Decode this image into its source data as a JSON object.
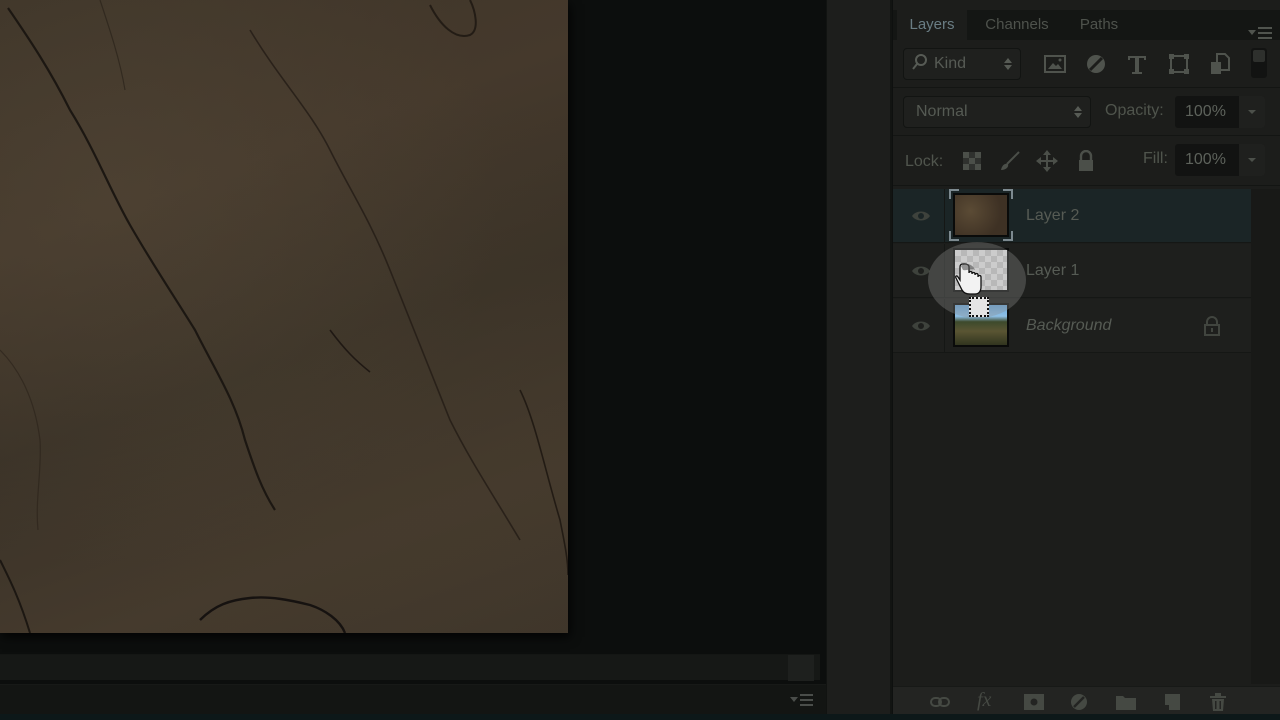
{
  "panel": {
    "tabs": [
      {
        "label": "Layers",
        "active": true
      },
      {
        "label": "Channels",
        "active": false
      },
      {
        "label": "Paths",
        "active": false
      }
    ],
    "filter": {
      "kind_label": "Kind",
      "icons": [
        "image-filter-icon",
        "adjustment-filter-icon",
        "type-filter-icon",
        "shape-filter-icon",
        "smart-object-filter-icon"
      ]
    },
    "blend_mode": "Normal",
    "opacity_label": "Opacity:",
    "opacity_value": "100%",
    "lock_label": "Lock:",
    "fill_label": "Fill:",
    "fill_value": "100%",
    "layers": [
      {
        "name": "Layer 2",
        "visible": true,
        "selected": true,
        "locked": false
      },
      {
        "name": "Layer 1",
        "visible": true,
        "selected": false,
        "locked": false
      },
      {
        "name": "Background",
        "visible": true,
        "selected": false,
        "locked": true
      }
    ],
    "footer_icons": [
      "link-layers-icon",
      "fx-icon",
      "add-mask-icon",
      "adjustment-layer-icon",
      "new-group-icon",
      "new-layer-icon",
      "delete-layer-icon"
    ],
    "fx_label": "fx"
  },
  "colors": {
    "selected_layer": "#1b2526",
    "panel_bg": "#1c1d1b",
    "canvas_texture": "#3f3529"
  }
}
